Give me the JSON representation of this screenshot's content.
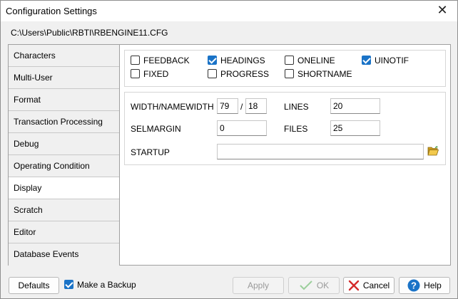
{
  "window": {
    "title": "Configuration Settings",
    "path": "C:\\Users\\Public\\RBTI\\RBENGINE11.CFG"
  },
  "tabs": [
    {
      "label": "Characters"
    },
    {
      "label": "Multi-User"
    },
    {
      "label": "Format"
    },
    {
      "label": "Transaction Processing"
    },
    {
      "label": "Debug"
    },
    {
      "label": "Operating Condition"
    },
    {
      "label": "Display",
      "active": true
    },
    {
      "label": "Scratch"
    },
    {
      "label": "Editor"
    },
    {
      "label": "Database Events"
    }
  ],
  "options": {
    "feedback": {
      "label": "FEEDBACK",
      "checked": false
    },
    "headings": {
      "label": "HEADINGS",
      "checked": true
    },
    "oneline": {
      "label": "ONELINE",
      "checked": false
    },
    "uinotif": {
      "label": "UINOTIF",
      "checked": true
    },
    "fixed": {
      "label": "FIXED",
      "checked": false
    },
    "progress": {
      "label": "PROGRESS",
      "checked": false
    },
    "shortname": {
      "label": "SHORTNAME",
      "checked": false
    }
  },
  "fields": {
    "width_label": "WIDTH/NAMEWIDTH",
    "width_value": "79",
    "separator": "/",
    "namewidth_value": "18",
    "lines_label": "LINES",
    "lines_value": "20",
    "selmargin_label": "SELMARGIN",
    "selmargin_value": "0",
    "files_label": "FILES",
    "files_value": "25",
    "startup_label": "STARTUP",
    "startup_value": ""
  },
  "footer": {
    "defaults_label": "Defaults",
    "backup_label": "Make a Backup",
    "backup_checked": true,
    "apply_label": "Apply",
    "ok_label": "OK",
    "cancel_label": "Cancel",
    "help_label": "Help"
  },
  "colors": {
    "accent": "#1a73c7",
    "cancel_red": "#d42a2a",
    "ok_green_disabled": "#9ccf9c",
    "folder_yellow": "#e8b830"
  }
}
